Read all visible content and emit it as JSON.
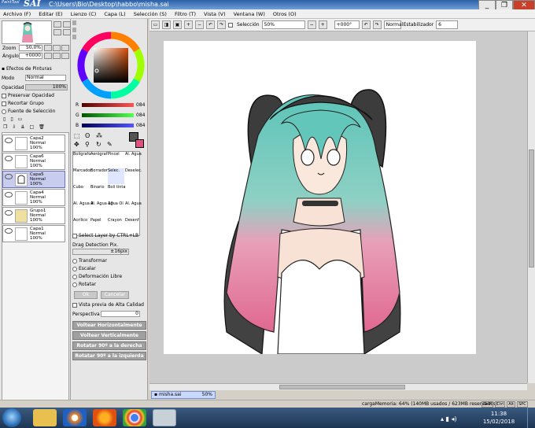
{
  "window": {
    "logo_text": "PaintTool",
    "app_name": "SAI",
    "path": "C:\\Users\\Bio\\Desktop\\habbo\\misha.sai",
    "controls": [
      "_",
      "❐",
      "✕"
    ]
  },
  "menu": [
    "Archivo (F)",
    "Editar (E)",
    "Lienzo (C)",
    "Capa (L)",
    "Selección (S)",
    "Filtro (T)",
    "Vista (V)",
    "Ventana (W)",
    "Otros (O)"
  ],
  "toolbar": {
    "selection_label": "Selección",
    "zoom": "50%",
    "rotation": "+000°",
    "blend": "Normal",
    "stabilizer_label": "Estabilizador",
    "stabilizer_value": "6"
  },
  "navigator": {
    "zoom_label": "Zoom",
    "zoom_value": "50,0%",
    "angle_label": "Ángulo",
    "angle_value": "+0000"
  },
  "layer_panel": {
    "effects_label": "Efectos de Pinturas",
    "mode_label": "Modo",
    "mode_value": "Normal",
    "opacity_label": "Opacidad",
    "opacity_value": "100%",
    "options": [
      "Preservar Opacidad",
      "Recortar Grupo",
      "Fuente de Selección"
    ],
    "layers": [
      {
        "name": "Capa2",
        "mode": "Normal",
        "opacity": "100%",
        "selected": false
      },
      {
        "name": "Capa6",
        "mode": "Normal",
        "opacity": "100%",
        "selected": false
      },
      {
        "name": "Capa5",
        "mode": "Normal",
        "opacity": "100%",
        "selected": true
      },
      {
        "name": "Capa4",
        "mode": "Normal",
        "opacity": "100%",
        "selected": false
      },
      {
        "name": "Grupo1",
        "mode": "Normal",
        "opacity": "100%",
        "selected": false
      },
      {
        "name": "Capa1",
        "mode": "Normal",
        "opacity": "100%",
        "selected": false
      }
    ]
  },
  "color": {
    "r_label": "R",
    "r_value": "084",
    "g_label": "G",
    "g_value": "084",
    "b_label": "B",
    "b_value": "084",
    "primary": "#545454",
    "secondary": "#e05080"
  },
  "brushes": [
    "Bolígrafo",
    "Aerógraf",
    "Pincel",
    "Al. Agua",
    "Marcador",
    "Borrador",
    "Selec.",
    "Deselec.",
    "Cubo",
    "Binario",
    "Boli tinta",
    "",
    "Al. Agua 9",
    "Al. Agua 10",
    "Agua Ol",
    "Al. Agua",
    "Acrílico",
    "Papel",
    "Crayon",
    "Desenf"
  ],
  "tool_options": {
    "select_layer": "Select Layer by CTRL+LB",
    "drag_detection": "Drag Detection Pix.",
    "drag_value": "±16pix",
    "transform_options": [
      "Transformar",
      "Escalar",
      "Deformación Libre",
      "Rotatar"
    ],
    "ok": "Ok",
    "cancel": "Cancelar",
    "preview": "Vista previa de Alta Calidad",
    "perspective_label": "Perspectiva",
    "perspective_value": "0",
    "buttons": [
      "Voltear Horizontalmente",
      "Voltear Verticalmente",
      "Rotatar 90º a la derecha",
      "Rotatar 90º a la izquierda"
    ]
  },
  "document_tab": {
    "name": "misha.sai",
    "zoom": "50%"
  },
  "status": {
    "memory": "cargaMemoria: 64% (140MB usados / 623MB reservados)",
    "keys": [
      "Shift",
      "Ctrl",
      "Alt",
      "SPC"
    ]
  },
  "taskbar": {
    "time": "11:38",
    "date": "15/02/2018"
  }
}
